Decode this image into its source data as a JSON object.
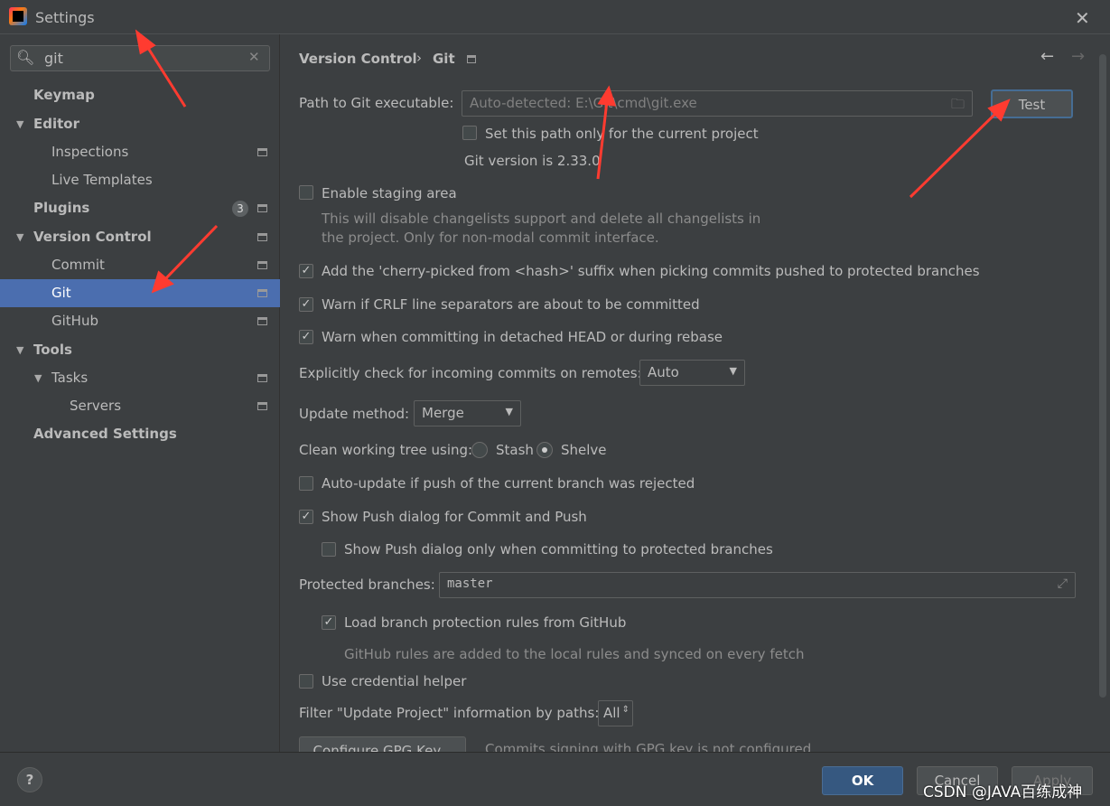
{
  "window": {
    "title": "Settings",
    "close": "✕"
  },
  "search": {
    "value": "git",
    "icon": "🔍︎",
    "clear": "✕"
  },
  "sidebar": {
    "items": [
      {
        "label": "Keymap"
      },
      {
        "label": "Editor"
      },
      {
        "label": "Inspections"
      },
      {
        "label": "Live Templates"
      },
      {
        "label": "Plugins",
        "badge": "3"
      },
      {
        "label": "Version Control"
      },
      {
        "label": "Commit"
      },
      {
        "label": "Git"
      },
      {
        "label": "GitHub"
      },
      {
        "label": "Tools"
      },
      {
        "label": "Tasks"
      },
      {
        "label": "Servers"
      },
      {
        "label": "Advanced Settings"
      }
    ]
  },
  "breadcrumb": {
    "parent": "Version Control",
    "sep": "›",
    "current": "Git",
    "back": "←",
    "forward": "→"
  },
  "git": {
    "path_label": "Path to Git executable:",
    "path_placeholder": "Auto-detected: E:\\Git\\cmd\\git.exe",
    "test": "Test",
    "set_path_only": "Set this path only for the current project",
    "version": "Git version is 2.33.0",
    "staging": "Enable staging area",
    "staging_desc1": "This will disable changelists support and delete all changelists in",
    "staging_desc2": "the project. Only for non-modal commit interface.",
    "cherry": "Add the 'cherry-picked from <hash>' suffix when picking commits pushed to protected branches",
    "crlf": "Warn if CRLF line separators are about to be committed",
    "detached": "Warn when committing in detached HEAD or during rebase",
    "incoming_label": "Explicitly check for incoming commits on remotes:",
    "incoming_value": "Auto",
    "update_label": "Update method:",
    "update_value": "Merge",
    "clean_label": "Clean working tree using:",
    "stash": "Stash",
    "shelve": "Shelve",
    "auto_update": "Auto-update if push of the current branch was rejected",
    "show_push": "Show Push dialog for Commit and Push",
    "show_push_protected": "Show Push dialog only when committing to protected branches",
    "protected_label": "Protected branches:",
    "protected_value": "master",
    "load_rules": "Load branch protection rules from GitHub",
    "rules_desc": "GitHub rules are added to the local rules and synced on every fetch",
    "credential": "Use credential helper",
    "filter_label": "Filter \"Update Project\" information by paths:",
    "filter_value": "All",
    "gpg_button": "Configure GPG Key...",
    "gpg_status": "Commits signing with GPG key is not configured"
  },
  "footer": {
    "help": "?",
    "ok": "OK",
    "cancel": "Cancel",
    "apply": "Apply",
    "watermark": "CSDN @JAVA百练成神"
  },
  "colors": {
    "selection": "#4b6eaf",
    "ok": "#365880",
    "annotation": "#ff3b30"
  }
}
